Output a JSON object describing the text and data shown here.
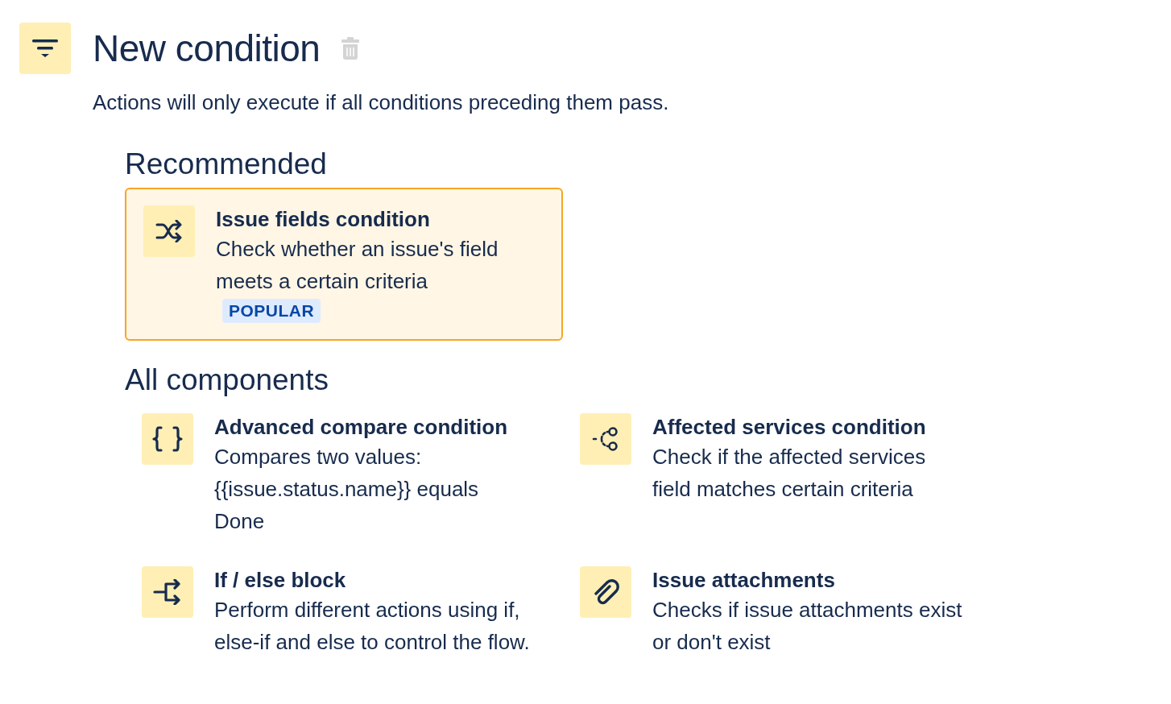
{
  "header": {
    "title": "New condition",
    "description": "Actions will only execute if all conditions preceding them pass."
  },
  "recommended": {
    "heading": "Recommended",
    "items": [
      {
        "title": "Issue fields condition",
        "description": "Check whether an issue's field meets a certain criteria",
        "badge": "POPULAR",
        "selected": true
      }
    ]
  },
  "all_components": {
    "heading": "All components",
    "items": [
      {
        "title": "Advanced compare condition",
        "description": "Compares two values: {{issue.status.name}} equals Done"
      },
      {
        "title": "Affected services condition",
        "description": "Check if the affected services field matches certain criteria"
      },
      {
        "title": "If / else block",
        "description": "Perform different actions using if, else-if and else to control the flow."
      },
      {
        "title": "Issue attachments",
        "description": "Checks if issue attachments exist or don't exist"
      }
    ]
  }
}
